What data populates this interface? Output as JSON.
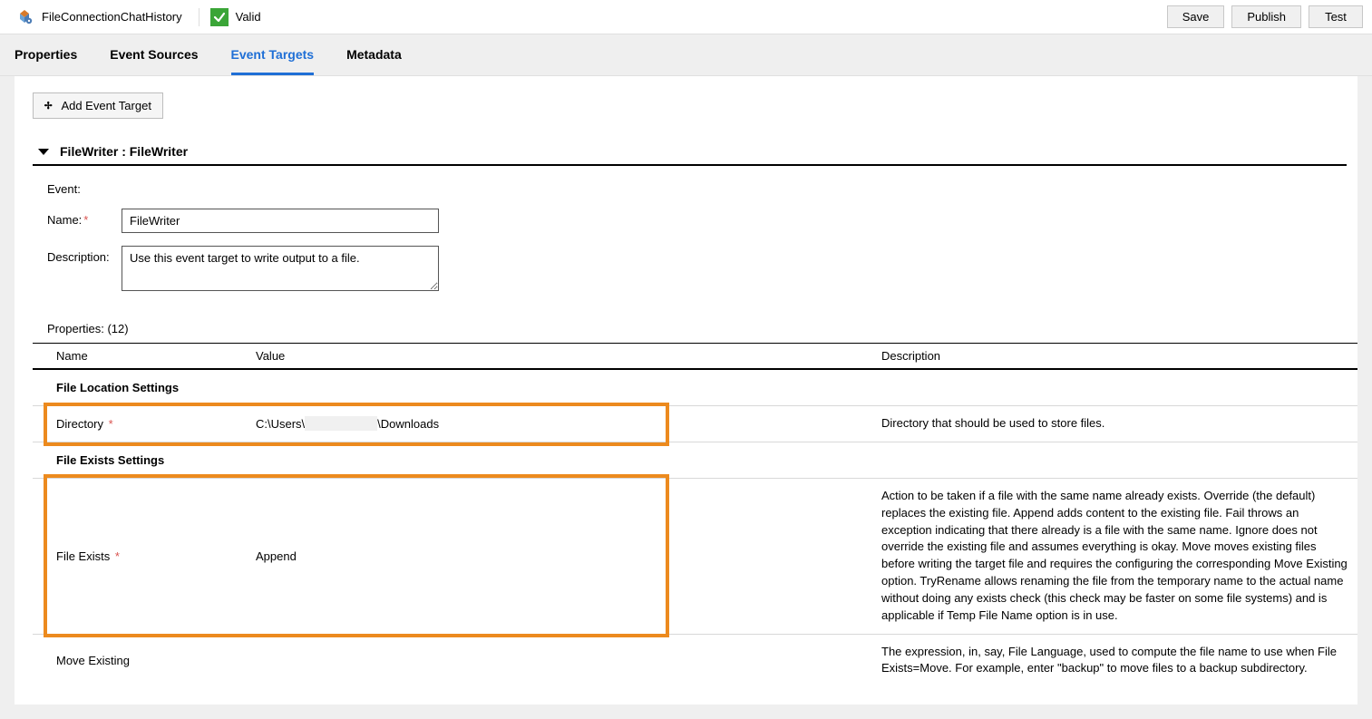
{
  "header": {
    "title": "FileConnectionChatHistory",
    "valid_label": "Valid"
  },
  "buttons": {
    "save": "Save",
    "publish": "Publish",
    "test": "Test"
  },
  "tabs": {
    "properties": "Properties",
    "event_sources": "Event Sources",
    "event_targets": "Event Targets",
    "metadata": "Metadata",
    "active": "event_targets"
  },
  "actions": {
    "add_event_target": "Add Event Target"
  },
  "section": {
    "title": "FileWriter : FileWriter"
  },
  "event_form": {
    "event_label": "Event:",
    "name_label": "Name:",
    "name_value": "FileWriter",
    "description_label": "Description:",
    "description_value": "Use this event target to write output to a file."
  },
  "properties_label": "Properties: (12)",
  "table": {
    "col_name": "Name",
    "col_value": "Value",
    "col_description": "Description"
  },
  "groups": {
    "file_location": "File Location Settings",
    "file_exists": "File Exists Settings"
  },
  "rows": {
    "directory": {
      "name": "Directory",
      "value_prefix": "C:\\Users\\",
      "value_suffix": "\\Downloads",
      "description": "Directory that should be used to store files."
    },
    "file_exists": {
      "name": "File Exists",
      "value": "Append",
      "description": "Action to be taken if a file with the same name already exists. Override (the default) replaces the existing file. Append adds content to the existing file. Fail throws an exception indicating that there already is a file with the same name. Ignore does not override the existing file and assumes everything is okay. Move moves existing files before writing the target file and requires the configuring the corresponding Move Existing option. TryRename allows renaming the file from the temporary name to the actual name without doing any exists check (this check may be faster on some file systems) and is applicable if Temp File Name option is in use."
    },
    "move_existing": {
      "name": "Move Existing",
      "value": "",
      "description": "The expression, in, say, File Language, used to compute the file name to use when File Exists=Move. For example, enter \"backup\" to move files to a backup subdirectory."
    }
  }
}
